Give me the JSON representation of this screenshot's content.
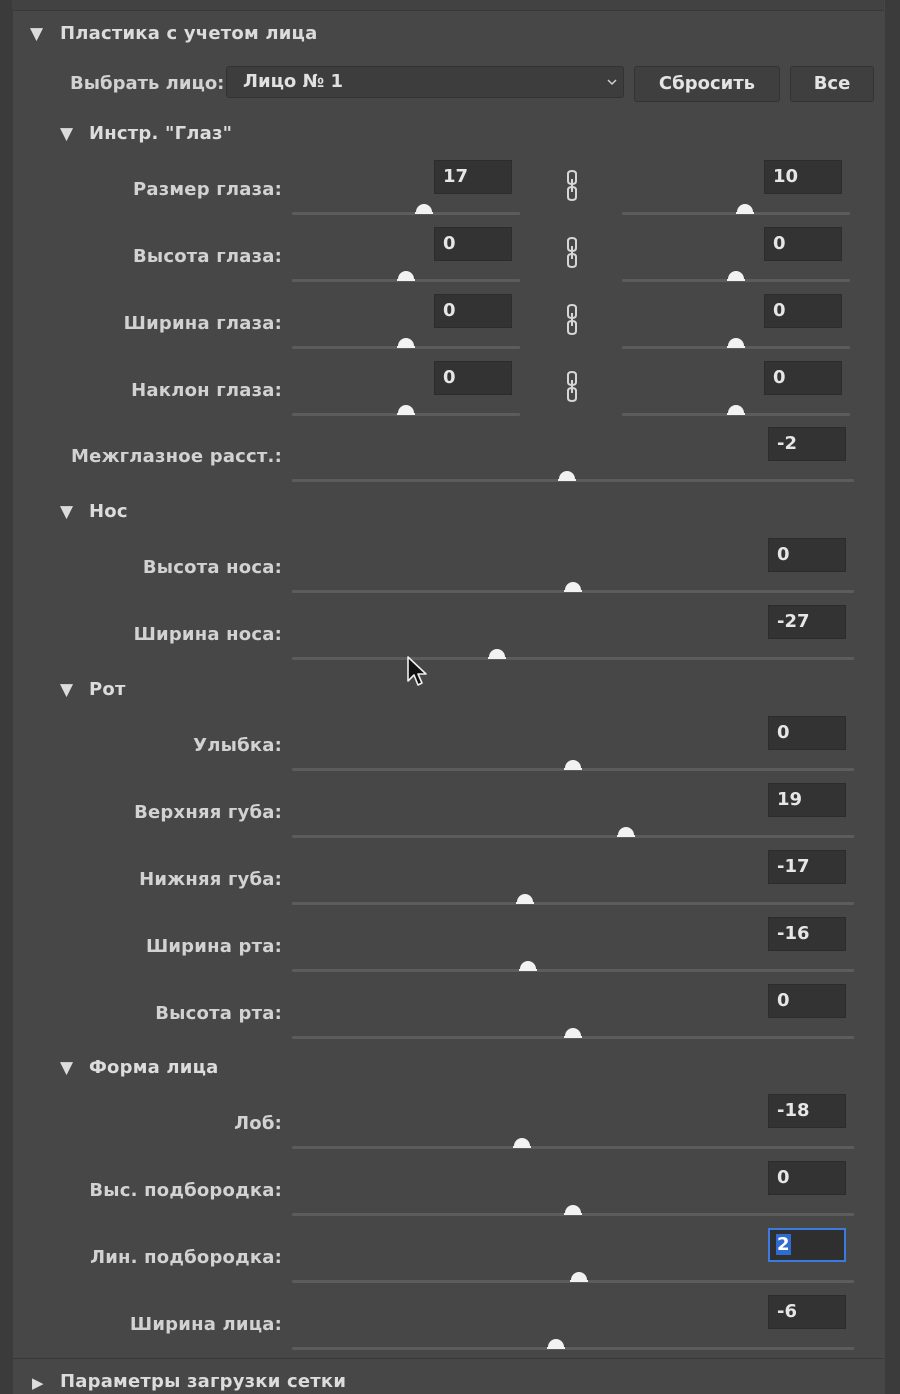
{
  "panel": {
    "title": "Пластика с учетом лица",
    "select_face_label": "Выбрать лицо:",
    "face_value": "Лицо № 1",
    "reset_label": "Сбросить",
    "all_label": "Все",
    "footer_title": "Параметры загрузки сетки"
  },
  "sections": {
    "eye": "Инстр. \"Глаз\"",
    "nose": "Нос",
    "mouth": "Рот",
    "face_shape": "Форма лица"
  },
  "eye_rows": [
    {
      "label": "Размер глаза:",
      "left": "17",
      "right": "10",
      "left_pos": 0.58,
      "right_pos": 0.54
    },
    {
      "label": "Высота глаза:",
      "left": "0",
      "right": "0",
      "left_pos": 0.5,
      "right_pos": 0.5
    },
    {
      "label": "Ширина глаза:",
      "left": "0",
      "right": "0",
      "left_pos": 0.5,
      "right_pos": 0.5
    },
    {
      "label": "Наклон глаза:",
      "left": "0",
      "right": "0",
      "left_pos": 0.5,
      "right_pos": 0.5
    }
  ],
  "eye_distance": {
    "label": "Межглазное расст.:",
    "value": "-2",
    "pos": 0.49
  },
  "nose_rows": [
    {
      "label": "Высота носа:",
      "value": "0",
      "pos": 0.5
    },
    {
      "label": "Ширина носа:",
      "value": "-27",
      "pos": 0.365
    }
  ],
  "mouth_rows": [
    {
      "label": "Улыбка:",
      "value": "0",
      "pos": 0.5
    },
    {
      "label": "Верхняя губа:",
      "value": "19",
      "pos": 0.595
    },
    {
      "label": "Нижняя губа:",
      "value": "-17",
      "pos": 0.415
    },
    {
      "label": "Ширина рта:",
      "value": "-16",
      "pos": 0.42
    },
    {
      "label": "Высота рта:",
      "value": "0",
      "pos": 0.5
    }
  ],
  "face_rows": [
    {
      "label": "Лоб:",
      "value": "-18",
      "pos": 0.41
    },
    {
      "label": "Выс. подбородка:",
      "value": "0",
      "pos": 0.5
    },
    {
      "label": "Лин. подбородка:",
      "value": "2",
      "pos": 0.51,
      "active": true
    },
    {
      "label": "Ширина лица:",
      "value": "-6",
      "pos": 0.47
    }
  ]
}
